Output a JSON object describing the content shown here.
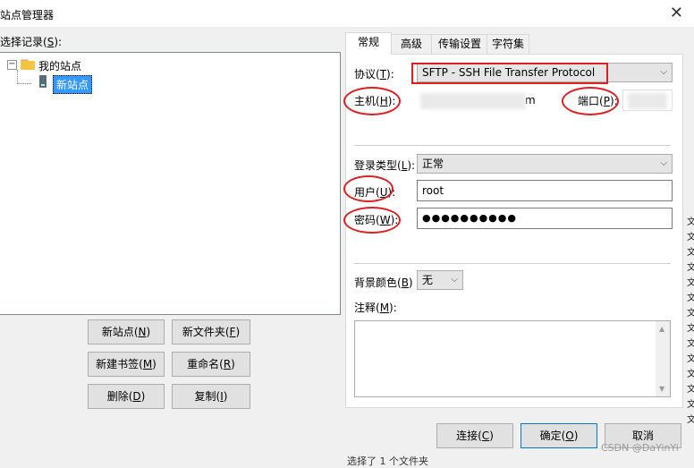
{
  "window": {
    "title": "站点管理器",
    "close_glyph": "✕"
  },
  "tree": {
    "label_text": "选择记录(",
    "label_key": "S",
    "label_end": "):",
    "root": "我的站点",
    "expander_glyph": "−",
    "child": "新站点"
  },
  "buttons": {
    "new_site": {
      "pre": "新站点(",
      "key": "N",
      "post": ")"
    },
    "new_folder": {
      "pre": "新文件夹(",
      "key": "F",
      "post": ")"
    },
    "new_bookmark": {
      "pre": "新建书签(",
      "key": "M",
      "post": ")"
    },
    "rename": {
      "pre": "重命名(",
      "key": "R",
      "post": ")"
    },
    "delete": {
      "pre": "删除(",
      "key": "D",
      "post": ")"
    },
    "copy": {
      "pre": "复制(",
      "key": "I",
      "post": ")"
    },
    "connect": {
      "pre": "连接(",
      "key": "C",
      "post": ")"
    },
    "ok": {
      "pre": "确定(",
      "key": "O",
      "post": ")"
    },
    "cancel": {
      "label": "取消"
    }
  },
  "tabs": [
    {
      "label": "常规",
      "active": true
    },
    {
      "label": "高级",
      "active": false
    },
    {
      "label": "传输设置",
      "active": false
    },
    {
      "label": "字符集",
      "active": false
    }
  ],
  "form": {
    "protocol": {
      "pre": "协议(",
      "key": "T",
      "post": "):",
      "value": "SFTP - SSH File Transfer Protocol"
    },
    "host": {
      "pre": "主机(",
      "key": "H",
      "post": "):",
      "value_suffix": "m"
    },
    "port": {
      "pre": "端口(",
      "key": "P",
      "post": "):"
    },
    "login_type": {
      "pre": "登录类型(",
      "key": "L",
      "post": "):",
      "value": "正常"
    },
    "user": {
      "pre": "用户(",
      "key": "U",
      "post": "):",
      "value": "root"
    },
    "password": {
      "pre": "密码(",
      "key": "W",
      "post": "):",
      "value": "●●●●●●●●●●"
    },
    "bg_color": {
      "pre": "背景颜色(",
      "key": "B",
      "post": ")",
      "value": "无"
    },
    "comment": {
      "pre": "注释(",
      "key": "M",
      "post": "):"
    }
  },
  "dropdown_glyph": "⌵",
  "scroll": {
    "up": "▲",
    "down": "▼"
  },
  "right_strip_glyph": "文",
  "status": "选择了 1 个文件夹",
  "watermark": "CSDN @DaYinYi",
  "colors": {
    "annotation_red": "#e02020",
    "selection_blue": "#3399ff"
  }
}
